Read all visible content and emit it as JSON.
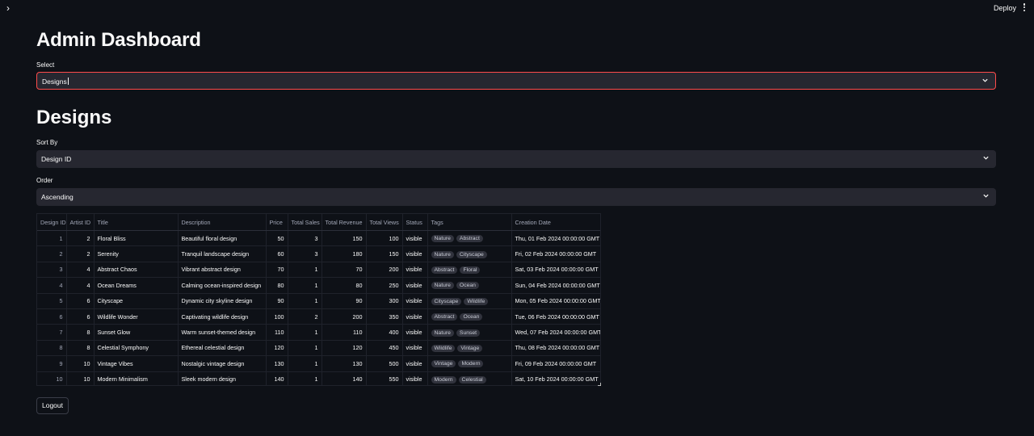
{
  "header": {
    "deploy_label": "Deploy",
    "expand_icon": "chevron-right-icon",
    "menu_icon": "vertical-ellipsis-icon"
  },
  "page": {
    "title": "Admin Dashboard",
    "select_label": "Select",
    "select_value": "Designs",
    "section_title": "Designs",
    "sort_label": "Sort By",
    "sort_value": "Design ID",
    "order_label": "Order",
    "order_value": "Ascending",
    "logout_label": "Logout"
  },
  "colors": {
    "background": "#0e1117",
    "input_background": "#262730",
    "focus_border": "#ff4b4b"
  },
  "table": {
    "columns": [
      "Design ID",
      "Artist ID",
      "Title",
      "Description",
      "Price",
      "Total Sales",
      "Total Revenue",
      "Total Views",
      "Status",
      "Tags",
      "Creation Date"
    ],
    "rows": [
      {
        "design_id": "1",
        "artist_id": "2",
        "title": "Floral Bliss",
        "description": "Beautiful floral design",
        "price": "50",
        "sales": "3",
        "revenue": "150",
        "views": "100",
        "status": "visible",
        "tags": [
          "Nature",
          "Abstract"
        ],
        "date": "Thu, 01 Feb 2024 00:00:00 GMT"
      },
      {
        "design_id": "2",
        "artist_id": "2",
        "title": "Serenity",
        "description": "Tranquil landscape design",
        "price": "60",
        "sales": "3",
        "revenue": "180",
        "views": "150",
        "status": "visible",
        "tags": [
          "Nature",
          "Cityscape"
        ],
        "date": "Fri, 02 Feb 2024 00:00:00 GMT"
      },
      {
        "design_id": "3",
        "artist_id": "4",
        "title": "Abstract Chaos",
        "description": "Vibrant abstract design",
        "price": "70",
        "sales": "1",
        "revenue": "70",
        "views": "200",
        "status": "visible",
        "tags": [
          "Abstract",
          "Floral"
        ],
        "date": "Sat, 03 Feb 2024 00:00:00 GMT"
      },
      {
        "design_id": "4",
        "artist_id": "4",
        "title": "Ocean Dreams",
        "description": "Calming ocean-inspired design",
        "price": "80",
        "sales": "1",
        "revenue": "80",
        "views": "250",
        "status": "visible",
        "tags": [
          "Nature",
          "Ocean"
        ],
        "date": "Sun, 04 Feb 2024 00:00:00 GMT"
      },
      {
        "design_id": "5",
        "artist_id": "6",
        "title": "Cityscape",
        "description": "Dynamic city skyline design",
        "price": "90",
        "sales": "1",
        "revenue": "90",
        "views": "300",
        "status": "visible",
        "tags": [
          "Cityscape",
          "Wildlife"
        ],
        "date": "Mon, 05 Feb 2024 00:00:00 GMT"
      },
      {
        "design_id": "6",
        "artist_id": "6",
        "title": "Wildlife Wonder",
        "description": "Captivating wildlife design",
        "price": "100",
        "sales": "2",
        "revenue": "200",
        "views": "350",
        "status": "visible",
        "tags": [
          "Abstract",
          "Ocean"
        ],
        "date": "Tue, 06 Feb 2024 00:00:00 GMT"
      },
      {
        "design_id": "7",
        "artist_id": "8",
        "title": "Sunset Glow",
        "description": "Warm sunset-themed design",
        "price": "110",
        "sales": "1",
        "revenue": "110",
        "views": "400",
        "status": "visible",
        "tags": [
          "Nature",
          "Sunset"
        ],
        "date": "Wed, 07 Feb 2024 00:00:00 GMT"
      },
      {
        "design_id": "8",
        "artist_id": "8",
        "title": "Celestial Symphony",
        "description": "Ethereal celestial design",
        "price": "120",
        "sales": "1",
        "revenue": "120",
        "views": "450",
        "status": "visible",
        "tags": [
          "Wildlife",
          "Vintage"
        ],
        "date": "Thu, 08 Feb 2024 00:00:00 GMT"
      },
      {
        "design_id": "9",
        "artist_id": "10",
        "title": "Vintage Vibes",
        "description": "Nostalgic vintage design",
        "price": "130",
        "sales": "1",
        "revenue": "130",
        "views": "500",
        "status": "visible",
        "tags": [
          "Vintage",
          "Modern"
        ],
        "date": "Fri, 09 Feb 2024 00:00:00 GMT"
      },
      {
        "design_id": "10",
        "artist_id": "10",
        "title": "Modern Minimalism",
        "description": "Sleek modern design",
        "price": "140",
        "sales": "1",
        "revenue": "140",
        "views": "550",
        "status": "visible",
        "tags": [
          "Modern",
          "Celestial"
        ],
        "date": "Sat, 10 Feb 2024 00:00:00 GMT"
      }
    ]
  }
}
